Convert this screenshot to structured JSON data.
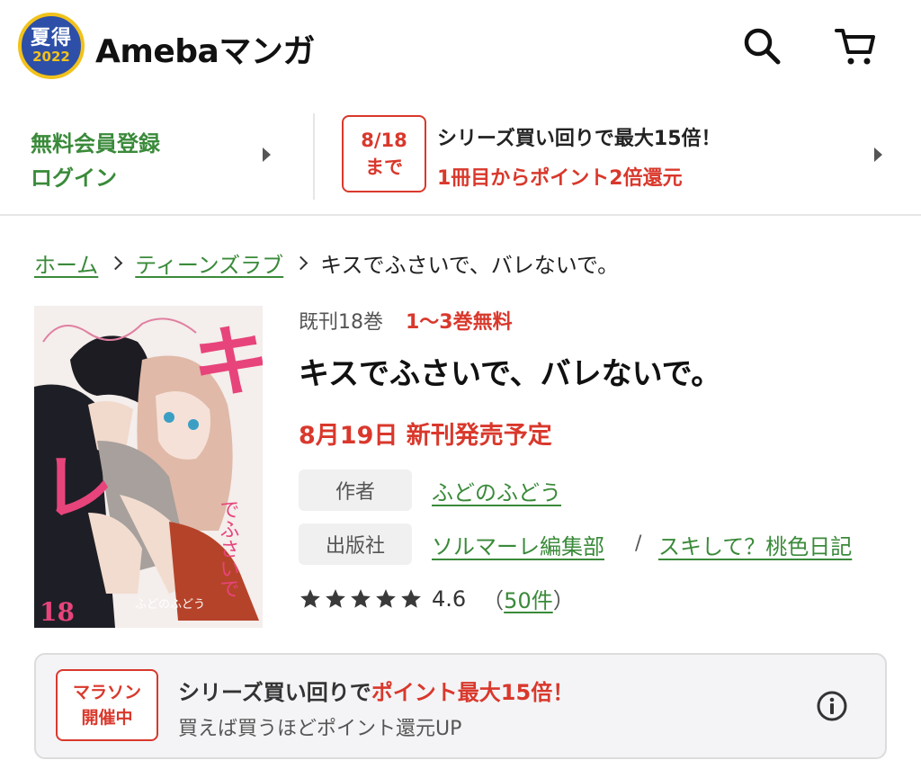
{
  "header": {
    "badge_line1": "夏得",
    "badge_line2": "2022",
    "logo_text": "Amebaマンガ",
    "icons": [
      "search-icon",
      "cart-icon"
    ]
  },
  "promo": {
    "member_register": "無料会員登録",
    "login": "ログイン",
    "campaign_date_line1": "8/18",
    "campaign_date_line2": "まで",
    "campaign_title": "シリーズ買い回りで最大15倍！",
    "campaign_sub": "1冊目からポイント2倍還元"
  },
  "breadcrumb": {
    "home": "ホーム",
    "category": "ティーンズラブ",
    "current": "キスでふさいで、バレないで。"
  },
  "cover": {
    "title_chars": "キス",
    "subtitle_chars": "でふさいで",
    "volume": "18",
    "author_caption": "ふどのふどう"
  },
  "book": {
    "volumes": "既刊18巻",
    "free_volumes": "1〜3巻無料",
    "title": "キスでふさいで、バレないで。",
    "release": "8月19日 新刊発売予定",
    "author_label": "作者",
    "author": "ふどのふどう",
    "publisher_label": "出版社",
    "publisher": "ソルマーレ編集部",
    "slash": "/",
    "label_imprint": "スキして？桃色日記",
    "rating_value": "4.6",
    "rating_stars": 5,
    "review_open": "（",
    "review_count": "50件",
    "review_close": "）"
  },
  "banner": {
    "box_line1": "マラソン",
    "box_line2": "開催中",
    "title_plain": "シリーズ買い回りで",
    "title_highlight": "ポイント最大15倍！",
    "subtitle": "買えば買うほどポイント還元UP"
  },
  "colors": {
    "green_link": "#3a8a3a",
    "red_accent": "#d9382c",
    "badge_blue": "#2d4fa8",
    "badge_gold": "#f2c21b"
  }
}
